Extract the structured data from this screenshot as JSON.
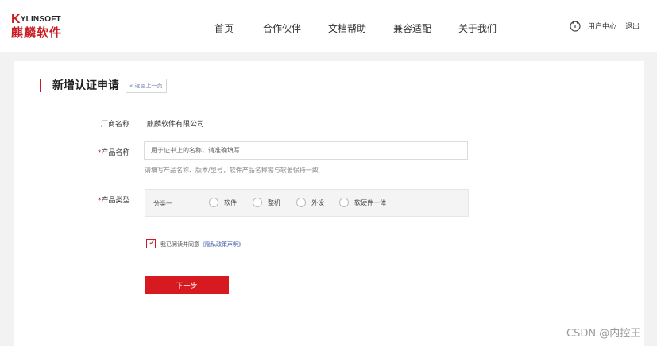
{
  "brand": {
    "logo_en_initial": "K",
    "logo_en_rest": "YLINSOFT",
    "logo_cn": "麒麟软件",
    "accent_color": "#c81c23"
  },
  "nav": {
    "items": [
      {
        "label": "首页"
      },
      {
        "label": "合作伙伴"
      },
      {
        "label": "文档帮助"
      },
      {
        "label": "兼容适配"
      },
      {
        "label": "关于我们"
      }
    ]
  },
  "user": {
    "icon": "lock-user-icon",
    "center_label": "用户中心",
    "logout_label": "退出"
  },
  "form": {
    "title": "新增认证申请",
    "back_label": "« 返回上一页",
    "vendor": {
      "label": "厂商名称",
      "value": "麒麟软件有限公司"
    },
    "product_name": {
      "required_mark": "*",
      "label": "产品名称",
      "placeholder": "用于证书上的名称，请准确填写",
      "value": "",
      "hint": "请填写产品名称、版本/型号，软件产品名称需与软著保持一致"
    },
    "product_type": {
      "required_mark": "*",
      "label": "产品类型",
      "category_label": "分类一",
      "options": [
        {
          "label": "软件",
          "selected": false
        },
        {
          "label": "整机",
          "selected": false
        },
        {
          "label": "外设",
          "selected": false
        },
        {
          "label": "软硬件一体",
          "selected": false
        }
      ]
    },
    "agreement": {
      "checked": true,
      "text": "我已阅读并同意",
      "link_text": "《隐私政策声明》"
    },
    "next_button_label": "下一步"
  },
  "watermark": "CSDN @内控王"
}
